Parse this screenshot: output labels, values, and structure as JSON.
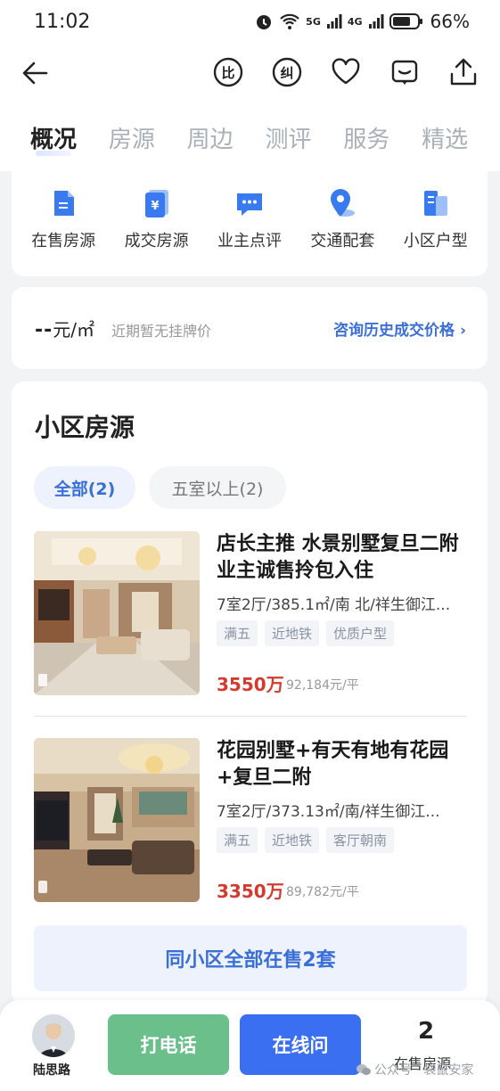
{
  "status": {
    "time": "11:02",
    "battery": "66%",
    "net1": "5G",
    "net2": "4G"
  },
  "tabs": [
    {
      "label": "概况"
    },
    {
      "label": "房源"
    },
    {
      "label": "周边"
    },
    {
      "label": "测评"
    },
    {
      "label": "服务"
    },
    {
      "label": "精选"
    }
  ],
  "quick": [
    {
      "label": "在售房源",
      "icon": "file-icon"
    },
    {
      "label": "成交房源",
      "icon": "yuan-icon"
    },
    {
      "label": "业主点评",
      "icon": "comment-icon"
    },
    {
      "label": "交通配套",
      "icon": "location-icon"
    },
    {
      "label": "小区户型",
      "icon": "floorplan-icon"
    }
  ],
  "price": {
    "value": "--",
    "unit": "元/㎡",
    "note": "近期暂无挂牌价",
    "link": "咨询历史成交价格 ›"
  },
  "listing": {
    "title": "小区房源",
    "filters": [
      {
        "label": "全部(2)"
      },
      {
        "label": "五室以上(2)"
      }
    ],
    "items": [
      {
        "name": "店长主推 水景别墅复旦二附业主诚售拎包入住",
        "spec": "7室2厅/385.1㎡/南 北/祥生御江...",
        "tags": [
          "满五",
          "近地铁",
          "优质户型"
        ],
        "price": "3550万",
        "unit_price": "92,184元/平"
      },
      {
        "name": "花园别墅+有天有地有花园+复旦二附",
        "spec": "7室2厅/373.13㎡/南/祥生御江...",
        "tags": [
          "满五",
          "近地铁",
          "客厅朝南"
        ],
        "price": "3350万",
        "unit_price": "89,782元/平"
      }
    ],
    "all_button": "同小区全部在售2套"
  },
  "bottom": {
    "agent_name": "陆思路",
    "call": "打电话",
    "chat": "在线问",
    "count": "2",
    "count_label": "在售房源",
    "watermark": "公众号 · 袋鼠安家"
  },
  "colors": {
    "accent": "#3b6fd8",
    "price_red": "#d43b2e",
    "call_green": "#6bbf8a",
    "chat_blue": "#3a6ff2"
  }
}
